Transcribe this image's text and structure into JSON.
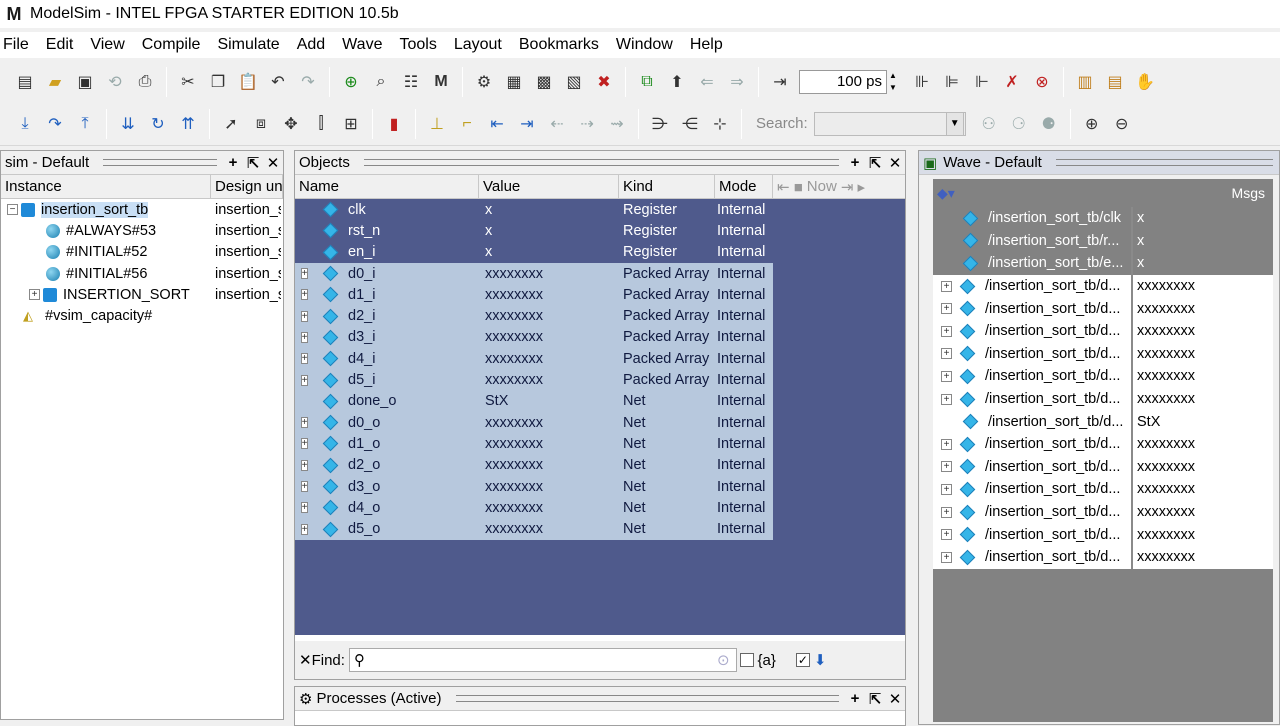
{
  "window": {
    "title": "ModelSim - INTEL FPGA STARTER EDITION 10.5b",
    "logo": "M"
  },
  "menu": [
    "File",
    "Edit",
    "View",
    "Compile",
    "Simulate",
    "Add",
    "Wave",
    "Tools",
    "Layout",
    "Bookmarks",
    "Window",
    "Help"
  ],
  "toolbar": {
    "time_value": "100 ps",
    "search_label": "Search:"
  },
  "sim_pane": {
    "title": "sim - Default",
    "columns": [
      "Instance",
      "Design uni"
    ],
    "rows": [
      {
        "name": "insertion_sort_tb",
        "design": "insertion_s",
        "level": 0,
        "expander": "−",
        "icon": "square",
        "selected": true
      },
      {
        "name": "#ALWAYS#53",
        "design": "insertion_s",
        "level": 1,
        "expander": "",
        "icon": "ball"
      },
      {
        "name": "#INITIAL#52",
        "design": "insertion_s",
        "level": 1,
        "expander": "",
        "icon": "ball"
      },
      {
        "name": "#INITIAL#56",
        "design": "insertion_s",
        "level": 1,
        "expander": "",
        "icon": "ball"
      },
      {
        "name": "INSERTION_SORT",
        "design": "insertion_s",
        "level": 1,
        "expander": "+",
        "icon": "square"
      },
      {
        "name": "#vsim_capacity#",
        "design": "",
        "level": 0,
        "expander": "",
        "icon": "cap"
      }
    ]
  },
  "objects_pane": {
    "title": "Objects",
    "columns": [
      "Name",
      "Value",
      "Kind",
      "Mode"
    ],
    "now_label": "Now",
    "rows": [
      {
        "name": "clk",
        "value": "x",
        "kind": "Register",
        "mode": "Internal",
        "expand": false,
        "style": "dark"
      },
      {
        "name": "rst_n",
        "value": "x",
        "kind": "Register",
        "mode": "Internal",
        "expand": false,
        "style": "dark"
      },
      {
        "name": "en_i",
        "value": "x",
        "kind": "Register",
        "mode": "Internal",
        "expand": false,
        "style": "dark"
      },
      {
        "name": "d0_i",
        "value": "xxxxxxxx",
        "kind": "Packed Array",
        "mode": "Internal",
        "expand": true,
        "style": "lite"
      },
      {
        "name": "d1_i",
        "value": "xxxxxxxx",
        "kind": "Packed Array",
        "mode": "Internal",
        "expand": true,
        "style": "lite"
      },
      {
        "name": "d2_i",
        "value": "xxxxxxxx",
        "kind": "Packed Array",
        "mode": "Internal",
        "expand": true,
        "style": "lite"
      },
      {
        "name": "d3_i",
        "value": "xxxxxxxx",
        "kind": "Packed Array",
        "mode": "Internal",
        "expand": true,
        "style": "lite"
      },
      {
        "name": "d4_i",
        "value": "xxxxxxxx",
        "kind": "Packed Array",
        "mode": "Internal",
        "expand": true,
        "style": "lite"
      },
      {
        "name": "d5_i",
        "value": "xxxxxxxx",
        "kind": "Packed Array",
        "mode": "Internal",
        "expand": true,
        "style": "lite"
      },
      {
        "name": "done_o",
        "value": "StX",
        "kind": "Net",
        "mode": "Internal",
        "expand": false,
        "style": "lite"
      },
      {
        "name": "d0_o",
        "value": "xxxxxxxx",
        "kind": "Net",
        "mode": "Internal",
        "expand": true,
        "style": "lite"
      },
      {
        "name": "d1_o",
        "value": "xxxxxxxx",
        "kind": "Net",
        "mode": "Internal",
        "expand": true,
        "style": "lite"
      },
      {
        "name": "d2_o",
        "value": "xxxxxxxx",
        "kind": "Net",
        "mode": "Internal",
        "expand": true,
        "style": "lite"
      },
      {
        "name": "d3_o",
        "value": "xxxxxxxx",
        "kind": "Net",
        "mode": "Internal",
        "expand": true,
        "style": "lite"
      },
      {
        "name": "d4_o",
        "value": "xxxxxxxx",
        "kind": "Net",
        "mode": "Internal",
        "expand": true,
        "style": "lite"
      },
      {
        "name": "d5_o",
        "value": "xxxxxxxx",
        "kind": "Net",
        "mode": "Internal",
        "expand": true,
        "style": "lite"
      }
    ],
    "find_label": "Find:",
    "find_extra": "{a}"
  },
  "processes_pane": {
    "title": "Processes (Active)"
  },
  "wave_pane": {
    "title": "Wave - Default",
    "msgs_label": "Msgs",
    "rows": [
      {
        "name": "/insertion_sort_tb/clk",
        "msg": "x",
        "expand": false,
        "style": "grey"
      },
      {
        "name": "/insertion_sort_tb/r...",
        "msg": "x",
        "expand": false,
        "style": "grey"
      },
      {
        "name": "/insertion_sort_tb/e...",
        "msg": "x",
        "expand": false,
        "style": "grey"
      },
      {
        "name": "/insertion_sort_tb/d...",
        "msg": "xxxxxxxx",
        "expand": true,
        "style": "light"
      },
      {
        "name": "/insertion_sort_tb/d...",
        "msg": "xxxxxxxx",
        "expand": true,
        "style": "light"
      },
      {
        "name": "/insertion_sort_tb/d...",
        "msg": "xxxxxxxx",
        "expand": true,
        "style": "light"
      },
      {
        "name": "/insertion_sort_tb/d...",
        "msg": "xxxxxxxx",
        "expand": true,
        "style": "light"
      },
      {
        "name": "/insertion_sort_tb/d...",
        "msg": "xxxxxxxx",
        "expand": true,
        "style": "light"
      },
      {
        "name": "/insertion_sort_tb/d...",
        "msg": "xxxxxxxx",
        "expand": true,
        "style": "light"
      },
      {
        "name": "/insertion_sort_tb/d...",
        "msg": "StX",
        "expand": false,
        "style": "light"
      },
      {
        "name": "/insertion_sort_tb/d...",
        "msg": "xxxxxxxx",
        "expand": true,
        "style": "light"
      },
      {
        "name": "/insertion_sort_tb/d...",
        "msg": "xxxxxxxx",
        "expand": true,
        "style": "light"
      },
      {
        "name": "/insertion_sort_tb/d...",
        "msg": "xxxxxxxx",
        "expand": true,
        "style": "light"
      },
      {
        "name": "/insertion_sort_tb/d...",
        "msg": "xxxxxxxx",
        "expand": true,
        "style": "light"
      },
      {
        "name": "/insertion_sort_tb/d...",
        "msg": "xxxxxxxx",
        "expand": true,
        "style": "light"
      },
      {
        "name": "/insertion_sort_tb/d...",
        "msg": "xxxxxxxx",
        "expand": true,
        "style": "light"
      }
    ]
  }
}
